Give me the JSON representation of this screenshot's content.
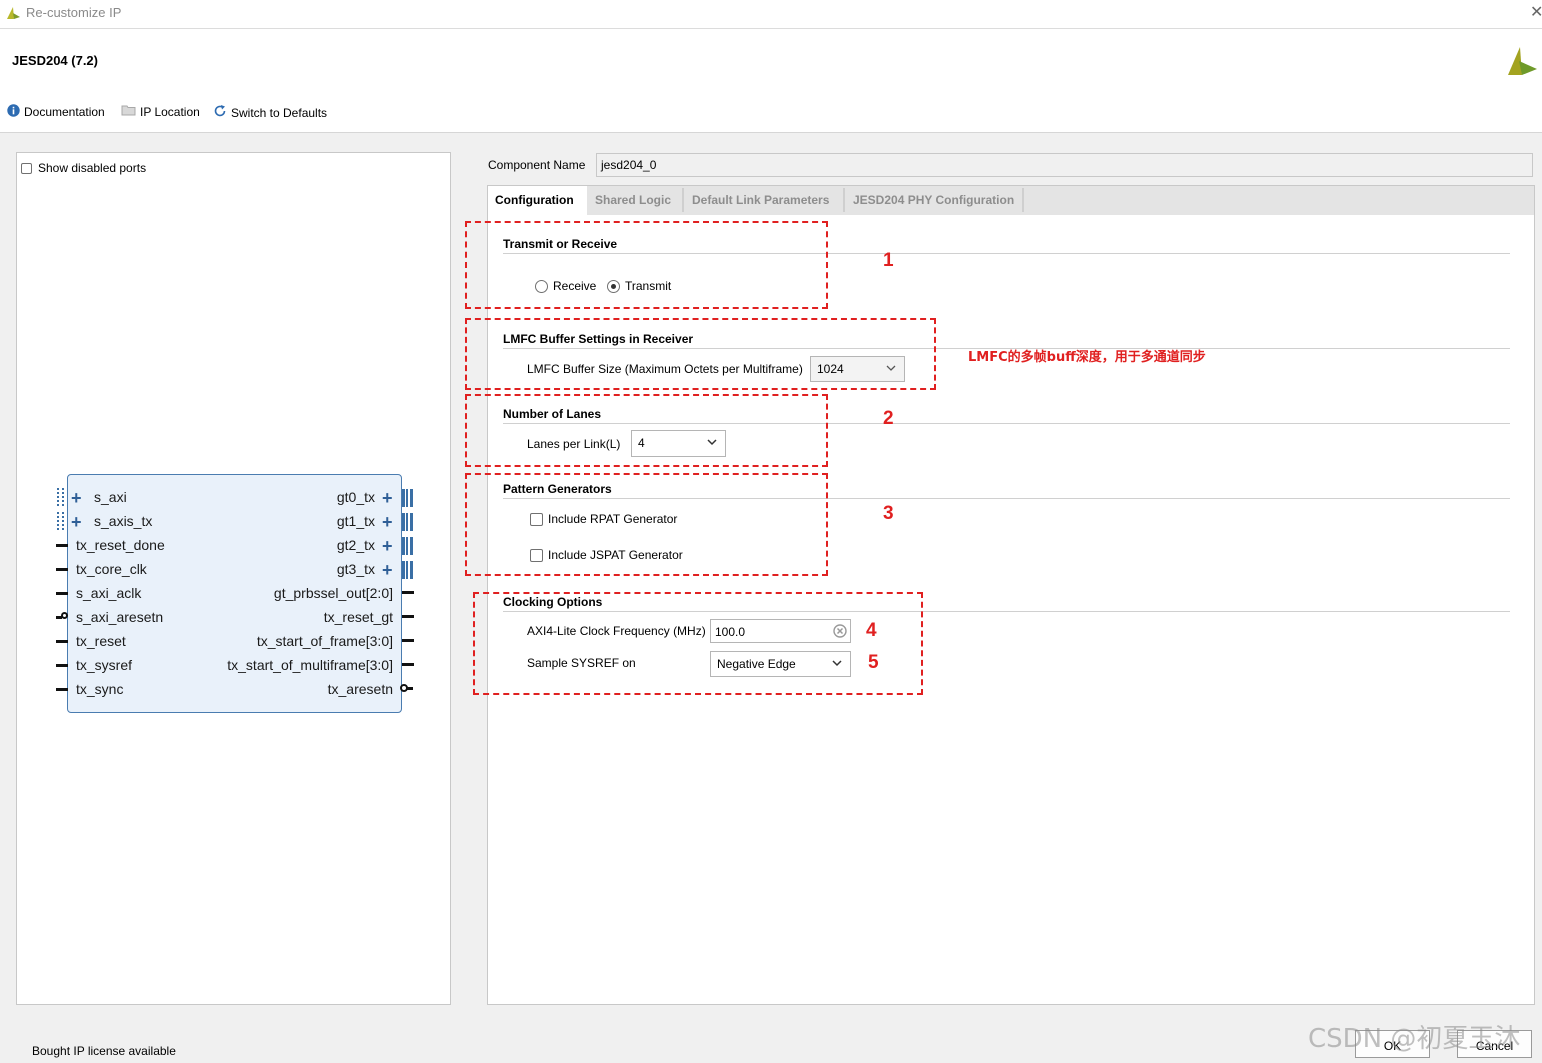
{
  "window": {
    "title": "Re-customize IP",
    "close_glyph": "✕"
  },
  "header": {
    "ip_name": "JESD204 (7.2)",
    "toolbar": {
      "documentation": "Documentation",
      "ip_location": "IP Location",
      "switch_defaults": "Switch to Defaults"
    }
  },
  "left_panel": {
    "show_disabled_ports_label": "Show disabled ports",
    "show_disabled_ports_checked": false,
    "symbol": {
      "left_ports": [
        "s_axi",
        "s_axis_tx",
        "tx_reset_done",
        "tx_core_clk",
        "s_axi_aclk",
        "s_axi_aresetn",
        "tx_reset",
        "tx_sysref",
        "tx_sync"
      ],
      "right_ports": [
        "gt0_tx",
        "gt1_tx",
        "gt2_tx",
        "gt3_tx",
        "gt_prbssel_out[2:0]",
        "tx_reset_gt",
        "tx_start_of_frame[3:0]",
        "tx_start_of_multiframe[3:0]",
        "tx_aresetn"
      ]
    }
  },
  "right_panel": {
    "component_name_label": "Component Name",
    "component_name_value": "jesd204_0",
    "tabs": [
      "Configuration",
      "Shared Logic",
      "Default Link Parameters",
      "JESD204 PHY Configuration"
    ],
    "active_tab": "Configuration",
    "sections": {
      "transmit_or_receive": {
        "title": "Transmit or Receive",
        "options": [
          "Receive",
          "Transmit"
        ],
        "selected": "Transmit"
      },
      "lmfc": {
        "title": "LMFC Buffer Settings in Receiver",
        "label": "LMFC Buffer Size (Maximum Octets per Multiframe)",
        "value": "1024"
      },
      "lanes": {
        "title": "Number of Lanes",
        "label": "Lanes per Link(L)",
        "value": "4"
      },
      "pattern": {
        "title": "Pattern Generators",
        "rpat_label": "Include RPAT Generator",
        "jspat_label": "Include JSPAT Generator",
        "rpat_checked": false,
        "jspat_checked": false
      },
      "clocking": {
        "title": "Clocking Options",
        "axi_clock_label": "AXI4-Lite Clock Frequency (MHz)",
        "axi_clock_value": "100.0",
        "sysref_label": "Sample SYSREF on",
        "sysref_value": "Negative Edge"
      }
    },
    "annotations": {
      "n1": "1",
      "n2": "2",
      "n3": "3",
      "n4": "4",
      "n5": "5",
      "lmfc_note": "LMFC的多帧buff深度，用于多通道同步"
    }
  },
  "footer": {
    "license_text": "Bought IP license available",
    "ok_label": "OK",
    "cancel_label": "Cancel",
    "watermark": "CSDN @初夏玉沐"
  },
  "colors": {
    "annotation_red": "#e02020",
    "symbol_fill": "#e9f1fa",
    "symbol_border": "#4a7cb0"
  },
  "icons": [
    "xilinx-logo-icon",
    "info-icon",
    "folder-icon",
    "refresh-icon",
    "chevron-down-icon",
    "clear-icon",
    "plus-icon"
  ]
}
